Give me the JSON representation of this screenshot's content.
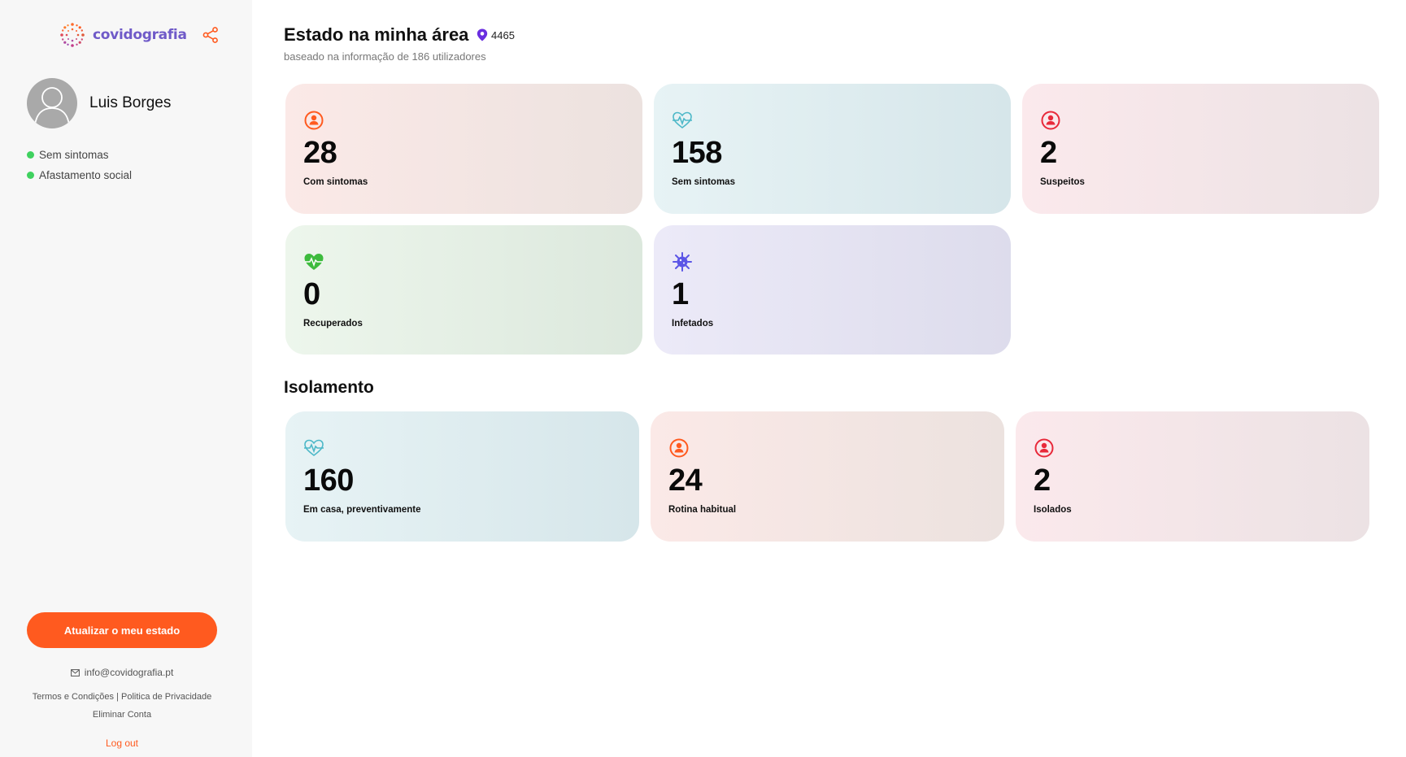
{
  "app": {
    "logo_text": "covidografia"
  },
  "sidebar": {
    "user_name": "Luis Borges",
    "statuses": [
      {
        "label": "Sem sintomas"
      },
      {
        "label": "Afastamento social"
      }
    ],
    "update_button": "Atualizar o meu estado",
    "email": "info@covidografia.pt",
    "terms": "Termos e Condições",
    "separator": " | ",
    "privacy": "Politica de Privacidade",
    "delete_account": "Eliminar Conta",
    "logout": "Log out"
  },
  "main": {
    "title": "Estado na minha área",
    "location_code": "4465",
    "subtitle": "baseado na informação de 186 utilizadores",
    "status_cards": [
      {
        "value": "28",
        "label": "Com sintomas",
        "icon": "person-circle-icon",
        "color": "#ff5a1f"
      },
      {
        "value": "158",
        "label": "Sem sintomas",
        "icon": "heartbeat-outline-icon",
        "color": "#4db8c8"
      },
      {
        "value": "2",
        "label": "Suspeitos",
        "icon": "person-circle-icon",
        "color": "#e8293a"
      },
      {
        "value": "0",
        "label": "Recuperados",
        "icon": "heart-pulse-icon",
        "color": "#3dbb3d"
      },
      {
        "value": "1",
        "label": "Infetados",
        "icon": "virus-icon",
        "color": "#5b55e6"
      }
    ],
    "isolation_title": "Isolamento",
    "isolation_cards": [
      {
        "value": "160",
        "label": "Em casa, preventivamente",
        "icon": "heartbeat-outline-icon",
        "color": "#4db8c8"
      },
      {
        "value": "24",
        "label": "Rotina habitual",
        "icon": "person-circle-icon",
        "color": "#ff5a1f"
      },
      {
        "value": "2",
        "label": "Isolados",
        "icon": "person-circle-icon",
        "color": "#e8293a"
      }
    ]
  },
  "colors": {
    "accent": "#ff5a1f",
    "brand": "#6f5ac8",
    "status_dot": "#3fd15f",
    "location_pin": "#6a2ee0"
  }
}
